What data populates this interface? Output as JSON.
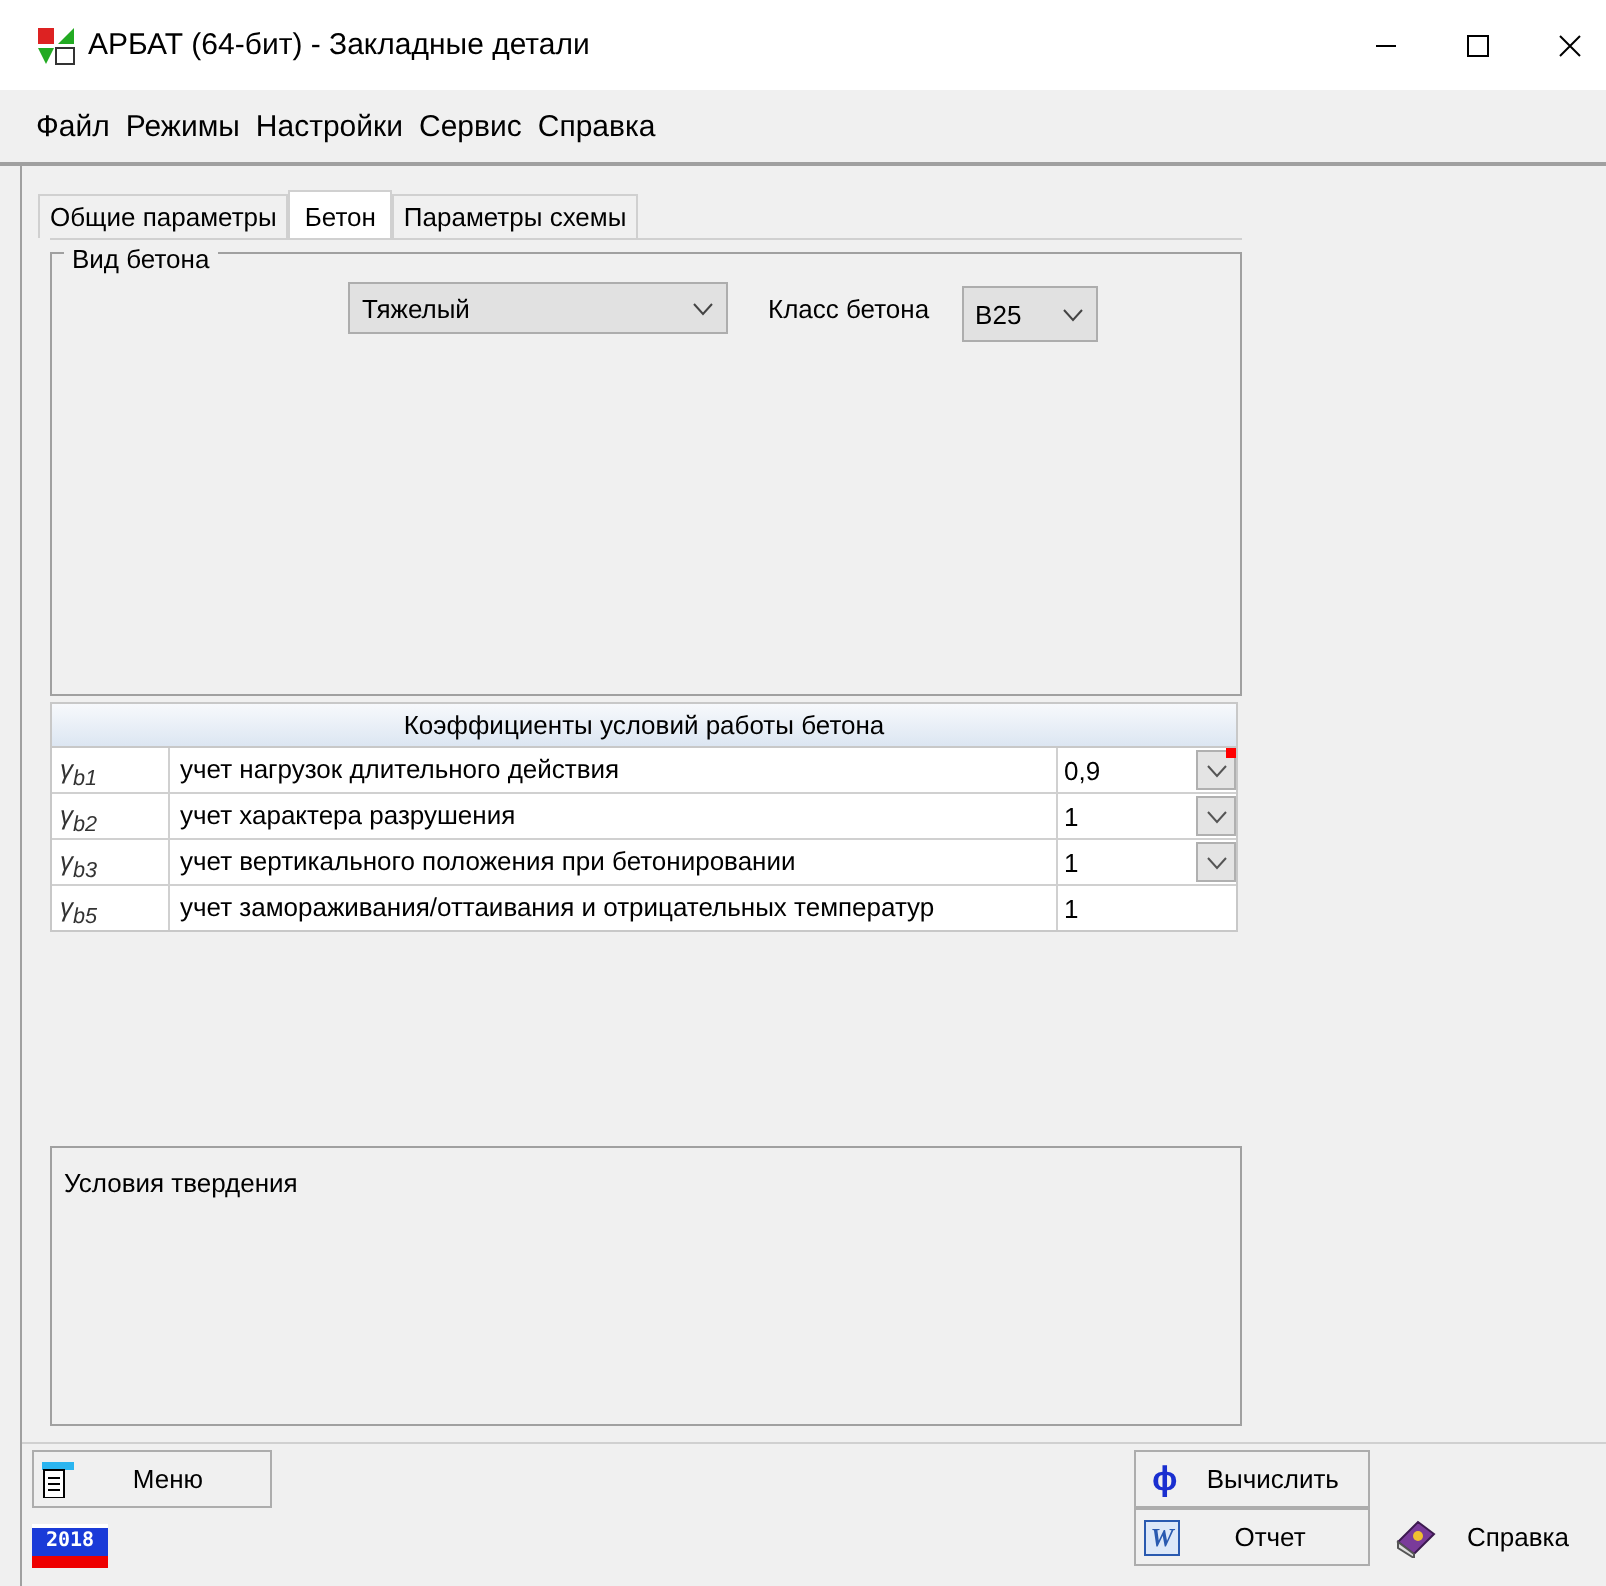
{
  "window": {
    "title": "АРБАТ (64-бит) - Закладные детали"
  },
  "menu": [
    "Файл",
    "Режимы",
    "Настройки",
    "Сервис",
    "Справка"
  ],
  "tabs": [
    {
      "label": "Общие параметры",
      "selected": false
    },
    {
      "label": "Бетон",
      "selected": true
    },
    {
      "label": "Параметры схемы",
      "selected": false
    }
  ],
  "concrete_group": {
    "title": "Вид бетона",
    "type_value": "Тяжелый",
    "class_label": "Класс бетона",
    "class_value": "B25"
  },
  "table": {
    "title": "Коэффициенты условий работы бетона",
    "rows": [
      {
        "symbol": "γ$_{b1}$",
        "description": "учет нагрузок длительного действия",
        "value": "0,9",
        "kind": "dropdown",
        "modified": true
      },
      {
        "symbol": "γ$_{b2}$",
        "description": "учет характера разрушения",
        "value": "1",
        "kind": "dropdown",
        "modified": false
      },
      {
        "symbol": "γ$_{b3}$",
        "description": "учет вертикального положения при бетонировании",
        "value": "1",
        "kind": "dropdown",
        "modified": false
      },
      {
        "symbol": "γ$_{b5}$",
        "description": "учет замораживания/оттаивания и отрицательных температур",
        "value": "1",
        "kind": "text",
        "modified": false
      }
    ]
  },
  "hardening": {
    "title": "Условия твердения"
  },
  "buttons": {
    "menu": "Меню",
    "calculate": {
      "icon": "ϕ",
      "label": "Вычислить"
    },
    "report": {
      "icon": "W",
      "label": "Отчет"
    },
    "help": "Справка"
  },
  "version_badge": "2018"
}
